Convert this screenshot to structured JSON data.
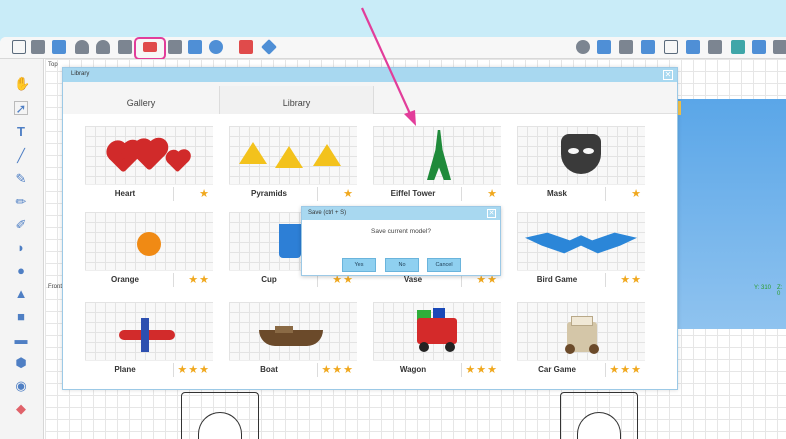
{
  "toolbar": {
    "left_icons": [
      "new-file-icon",
      "open-folder-icon",
      "save-icon",
      "undo-icon",
      "redo-icon",
      "cut-icon",
      "library-icon",
      "book-icon",
      "copy-icon",
      "globe-icon",
      "align-icon",
      "diamond-icon"
    ],
    "right_icons": [
      "user-icon",
      "share-icon",
      "print-icon",
      "flash-icon",
      "fit-icon",
      "grid-icon",
      "cube-icon",
      "preview-icon",
      "columns-icon",
      "settings-icon"
    ],
    "highlight_color": "#e23d9a"
  },
  "left_tools": [
    "hand-icon",
    "pointer-icon",
    "text-tool-icon",
    "line-tool-icon",
    "pen-tool-icon",
    "pencil-tool-icon",
    "brush-tool-icon",
    "half-circle-icon",
    "circle-icon",
    "triangle-icon",
    "square-icon",
    "rectangle-icon",
    "hexagon-icon",
    "sphere-icon",
    "eraser-icon"
  ],
  "workspace": {
    "top_label": "Top",
    "front_label": "Front",
    "coords": [
      "Y: 310",
      "Z: 0"
    ]
  },
  "library": {
    "title": "Library",
    "tabs": [
      {
        "label": "Gallery"
      },
      {
        "label": "Library"
      }
    ],
    "items": [
      {
        "name": "Heart",
        "stars": "★"
      },
      {
        "name": "Pyramids",
        "stars": "★"
      },
      {
        "name": "Eiffel Tower",
        "stars": "★"
      },
      {
        "name": "Mask",
        "stars": "★"
      },
      {
        "name": "Orange",
        "stars": "★★"
      },
      {
        "name": "Cup",
        "stars": "★★"
      },
      {
        "name": "Vase",
        "stars": "★★"
      },
      {
        "name": "Bird Game",
        "stars": "★★"
      },
      {
        "name": "Plane",
        "stars": "★★★"
      },
      {
        "name": "Boat",
        "stars": "★★★"
      },
      {
        "name": "Wagon",
        "stars": "★★★"
      },
      {
        "name": "Car Game",
        "stars": "★★★"
      }
    ]
  },
  "save_dialog": {
    "title": "Save (ctrl + S)",
    "message": "Save current model?",
    "yes_label": "Yes",
    "no_label": "No",
    "cancel_label": "Cancel"
  },
  "colors": {
    "accent": "#a8d8f0",
    "star": "#f0a81e",
    "annotation": "#e23d9a"
  }
}
